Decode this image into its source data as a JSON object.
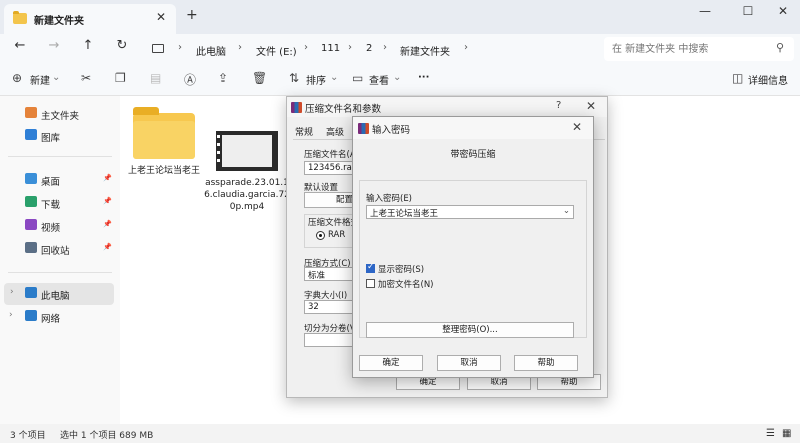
{
  "window": {
    "tab_title": "新建文件夹",
    "tab_close": "✕",
    "new_tab": "+",
    "minimize": "—",
    "maximize": "☐",
    "close": "✕"
  },
  "nav": {
    "back": "←",
    "forward": "→",
    "up": "↑",
    "refresh": "↻",
    "breadcrumbs": [
      "此电脑",
      "文件 (E:)",
      "111",
      "2",
      "新建文件夹"
    ],
    "search_placeholder": "在 新建文件夹 中搜索"
  },
  "toolbar": {
    "new_label": "新建",
    "sort_label": "排序",
    "view_label": "查看",
    "more": "···",
    "details_label": "详细信息"
  },
  "sidebar": {
    "items": [
      {
        "label": "主文件夹",
        "color": "#e5833a"
      },
      {
        "label": "图库",
        "color": "#2f7fd6"
      },
      {
        "label": "桌面",
        "color": "#3a8fd8",
        "pinned": true
      },
      {
        "label": "下载",
        "color": "#2aa06b",
        "pinned": true
      },
      {
        "label": "视频",
        "color": "#8a48c2",
        "pinned": true
      },
      {
        "label": "回收站",
        "color": "#5b6f86",
        "pinned": true
      },
      {
        "label": "此电脑",
        "color": "#2b7cc9",
        "selected": true
      },
      {
        "label": "网络",
        "color": "#2b7cc9"
      }
    ],
    "pin_glyph": "📌"
  },
  "files": [
    {
      "name": "上老王论坛当老王",
      "type": "folder"
    },
    {
      "name": "assparade.23.01.16.claudia.garcia.720p.mp4",
      "type": "video"
    }
  ],
  "status": {
    "count": "3 个项目",
    "selected": "选中 1 个项目  689 MB"
  },
  "dialog_archive": {
    "title": "压缩文件名和参数",
    "help_q": "?",
    "close": "✕",
    "tabs": [
      "常规",
      "高级"
    ],
    "archive_name_label": "压缩文件名(A)",
    "archive_name_value": "123456.rar",
    "default_settings_label": "默认设置",
    "profiles_button": "配置",
    "format_label": "压缩文件格式",
    "format_rar": "RAR",
    "method_label": "压缩方式(C)",
    "method_value": "标准",
    "dict_label": "字典大小(I)",
    "dict_value": "32",
    "split_label": "切分为分卷(V)",
    "ok": "确定",
    "cancel": "取消",
    "help": "帮助"
  },
  "dialog_password": {
    "title": "输入密码",
    "close": "✕",
    "heading": "带密码压缩",
    "password_label": "输入密码(E)",
    "password_value": "上老王论坛当老王",
    "show_password": "显示密码(S)",
    "show_password_checked": true,
    "encrypt_names": "加密文件名(N)",
    "encrypt_names_checked": false,
    "organize_button": "整理密码(O)...",
    "ok": "确定",
    "cancel": "取消",
    "help": "帮助"
  }
}
